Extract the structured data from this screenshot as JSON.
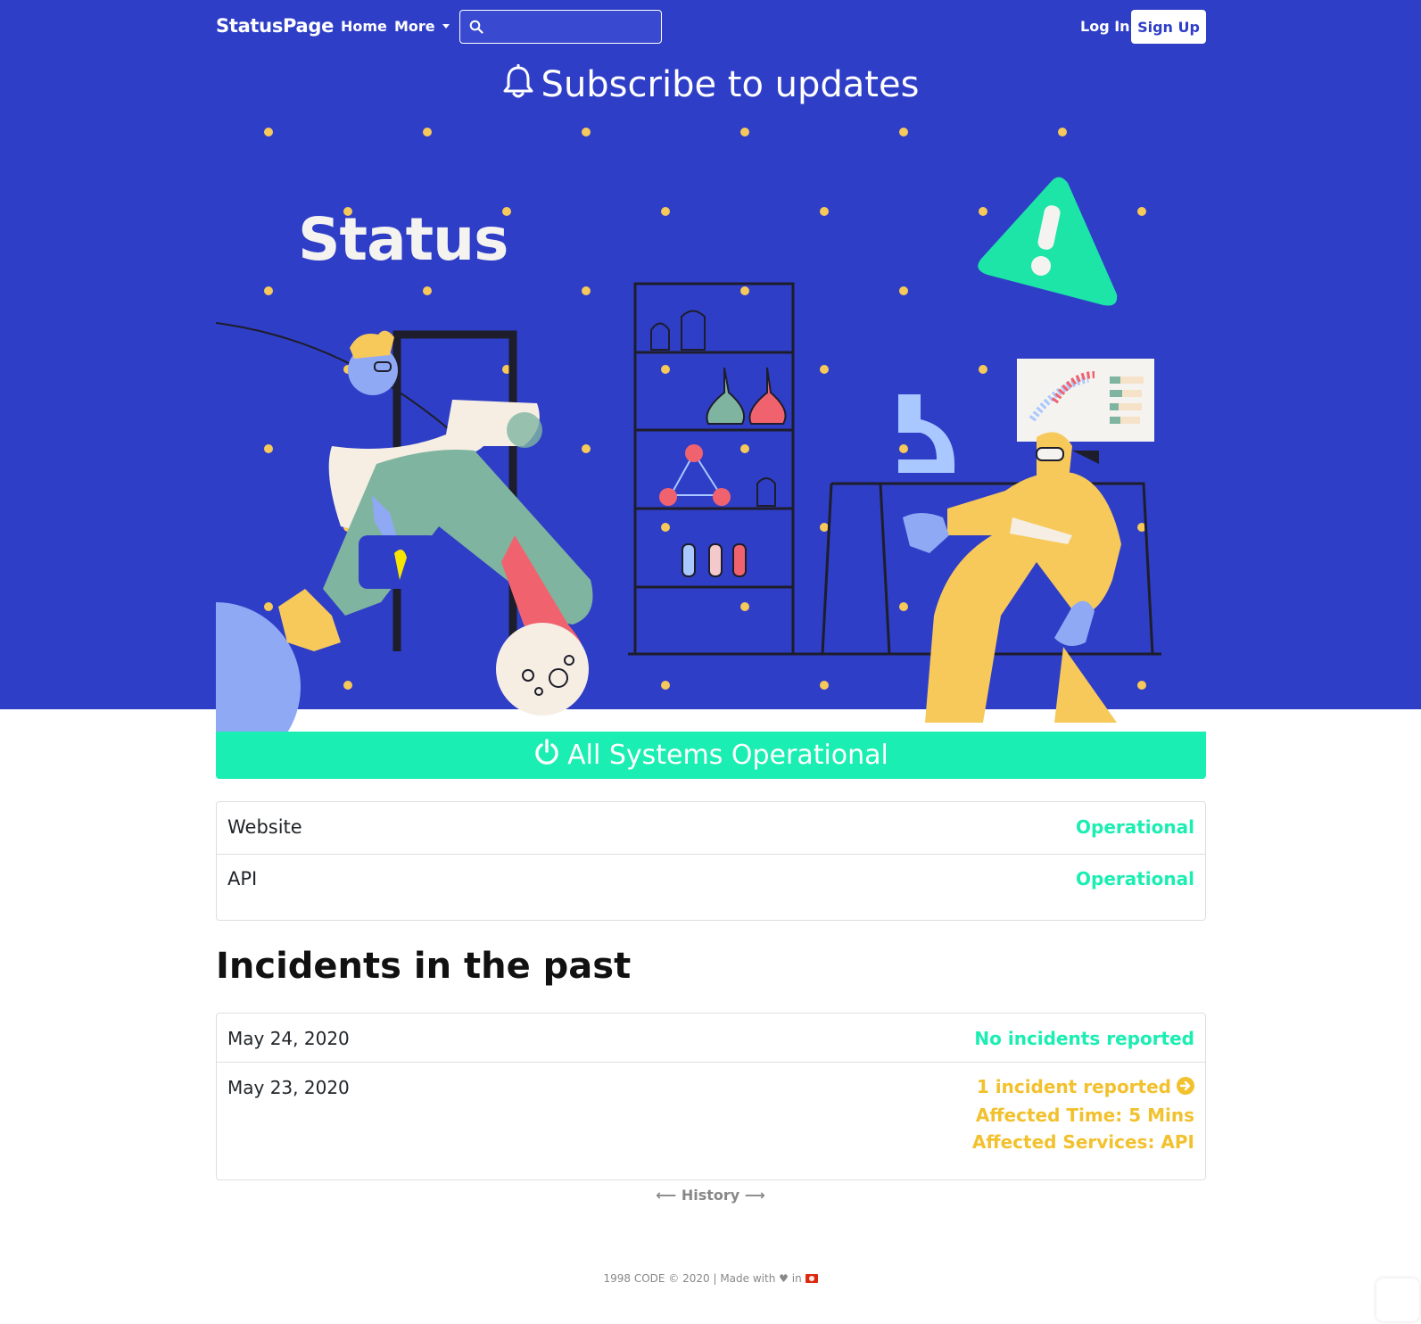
{
  "header": {
    "brand": "StatusPage",
    "nav": {
      "home": "Home",
      "more": "More"
    },
    "search": {
      "placeholder": "",
      "value": ""
    },
    "login": "Log In",
    "signup": "Sign Up"
  },
  "subscribe": {
    "label": "Subscribe to updates"
  },
  "illustration": {
    "title": "Status"
  },
  "status_banner": {
    "label": "All Systems Operational"
  },
  "services": [
    {
      "name": "Website",
      "status": "Operational"
    },
    {
      "name": "API",
      "status": "Operational"
    }
  ],
  "incidents": {
    "heading": "Incidents in the past",
    "days": [
      {
        "date": "May 24, 2020",
        "summary": "No incidents reported"
      },
      {
        "date": "May 23, 2020",
        "summary": "1 incident reported",
        "affected_time": "Affected Time: 5 Mins",
        "affected_services": "Affected Services: API"
      }
    ]
  },
  "history": {
    "label": "History"
  },
  "footer": {
    "left": "1998 CODE © 2020 | Made with",
    "right": "in"
  },
  "colors": {
    "brand_blue": "#2f3ec6",
    "operational_green": "#1beeb2",
    "incident_yellow": "#f2c12e"
  }
}
